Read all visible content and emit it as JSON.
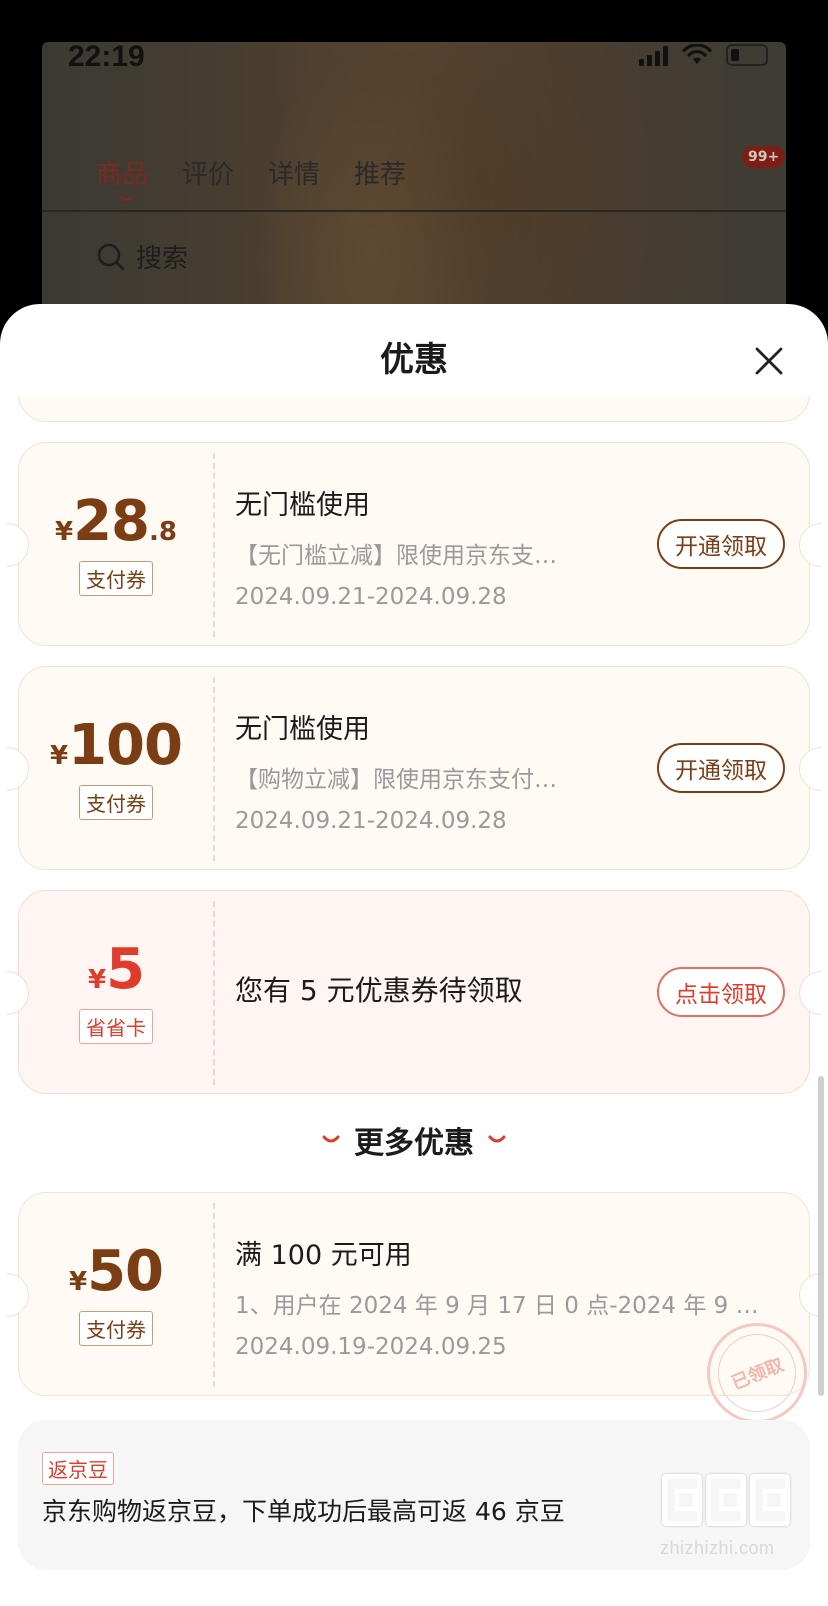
{
  "status_bar": {
    "time": "22:19"
  },
  "product_page": {
    "tabs": [
      {
        "label": "商品",
        "active": true
      },
      {
        "label": "评价",
        "active": false
      },
      {
        "label": "详情",
        "active": false
      },
      {
        "label": "推荐",
        "active": false
      }
    ],
    "message_badge": "99+",
    "search_label": "搜索"
  },
  "sheet": {
    "title": "优惠",
    "coupons": [
      {
        "currency": "¥",
        "amount": "28",
        "amount_decimal": ".8",
        "tag": "支付券",
        "title": "无门槛使用",
        "description": "【无门槛立减】限使用京东支…",
        "dates": "2024.09.21-2024.09.28",
        "action": "开通领取"
      },
      {
        "currency": "¥",
        "amount": "100",
        "amount_decimal": "",
        "tag": "支付券",
        "title": "无门槛使用",
        "description": "【购物立减】限使用京东支付…",
        "dates": "2024.09.21-2024.09.28",
        "action": "开通领取"
      },
      {
        "currency": "¥",
        "amount": "5",
        "tag": "省省卡",
        "title": "您有 5 元优惠券待领取",
        "action": "点击领取"
      }
    ],
    "more_section": {
      "label": "更多优惠",
      "coupon": {
        "currency": "¥",
        "amount": "50",
        "tag": "支付券",
        "title": "满 100 元可用",
        "description": "1、用户在 2024 年 9 月 17 日 0 点-2024 年 9 月…",
        "dates": "2024.09.19-2024.09.25",
        "stamp": "已领取"
      }
    },
    "bean_rebate": {
      "tag": "返京豆",
      "text": "京东购物返京豆，下单成功后最高可返 46 京豆"
    }
  },
  "watermark": {
    "text": "zhizhizhi.com"
  },
  "colors": {
    "brand_brown": "#7b3d14",
    "accent_red": "#e03c2c",
    "coupon_bg": "#fffaf4",
    "red_coupon_bg": "#fff6f4"
  }
}
